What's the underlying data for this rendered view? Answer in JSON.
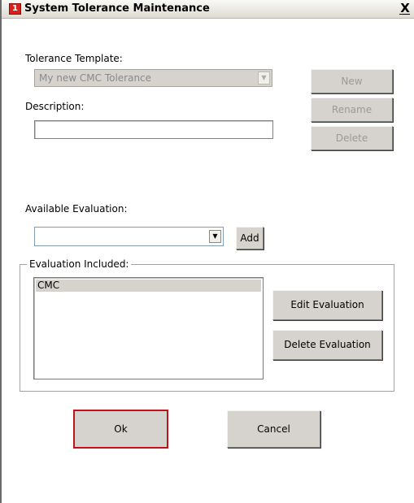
{
  "window": {
    "title": "System Tolerance Maintenance",
    "icon_glyph": "1",
    "close_glyph": "X"
  },
  "template": {
    "label": "Tolerance Template:",
    "selected_value": "My new CMC Tolerance",
    "disabled": true
  },
  "description": {
    "label": "Description:",
    "value": ""
  },
  "template_buttons": {
    "new_label": "New",
    "rename_label": "Rename",
    "delete_label": "Delete"
  },
  "available": {
    "label": "Available Evaluation:",
    "selected_value": "",
    "add_label": "Add"
  },
  "included": {
    "legend": "Evaluation Included:",
    "items": [
      "CMC"
    ],
    "edit_label": "Edit Evaluation",
    "delete_label": "Delete Evaluation"
  },
  "footer": {
    "ok_label": "Ok",
    "cancel_label": "Cancel"
  },
  "colors": {
    "accent_focus_border": "#c0121d",
    "app_icon": "#d8201c",
    "button_face": "#d6d3ce"
  },
  "icons": {
    "app": "app-icon",
    "close": "close-icon",
    "dropdown": "dropdown-arrow-icon"
  }
}
